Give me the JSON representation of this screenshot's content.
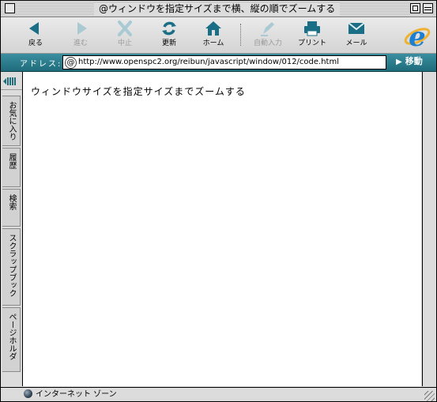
{
  "window": {
    "title": "@ウィンドウを指定サイズまで横、縦の順でズームする"
  },
  "toolbar": {
    "buttons": [
      {
        "label": "戻る",
        "icon": "back-arrow-icon",
        "enabled": true
      },
      {
        "label": "進む",
        "icon": "forward-arrow-icon",
        "enabled": false
      },
      {
        "label": "中止",
        "icon": "stop-icon",
        "enabled": false
      },
      {
        "label": "更新",
        "icon": "refresh-icon",
        "enabled": true
      },
      {
        "label": "ホーム",
        "icon": "home-icon",
        "enabled": true
      },
      {
        "label": "自動入力",
        "icon": "autofill-icon",
        "enabled": false
      },
      {
        "label": "プリント",
        "icon": "print-icon",
        "enabled": true
      },
      {
        "label": "メール",
        "icon": "mail-icon",
        "enabled": true
      }
    ]
  },
  "address": {
    "label": "アドレス:",
    "url": "http://www.openspc2.org/reibun/javascript/window/012/code.html",
    "go_label": "移動"
  },
  "sidebar": {
    "tabs": [
      "お気に入り",
      "履歴",
      "検索",
      "スクラップブック",
      "ページホルダ"
    ]
  },
  "content": {
    "text": "ウィンドウサイズを指定サイズまでズームする"
  },
  "status": {
    "zone": "インターネット ゾーン"
  },
  "colors": {
    "accent": "#1f6c7b",
    "toolbar_icon": "#1a6e86",
    "disabled": "#9a9a9a"
  }
}
